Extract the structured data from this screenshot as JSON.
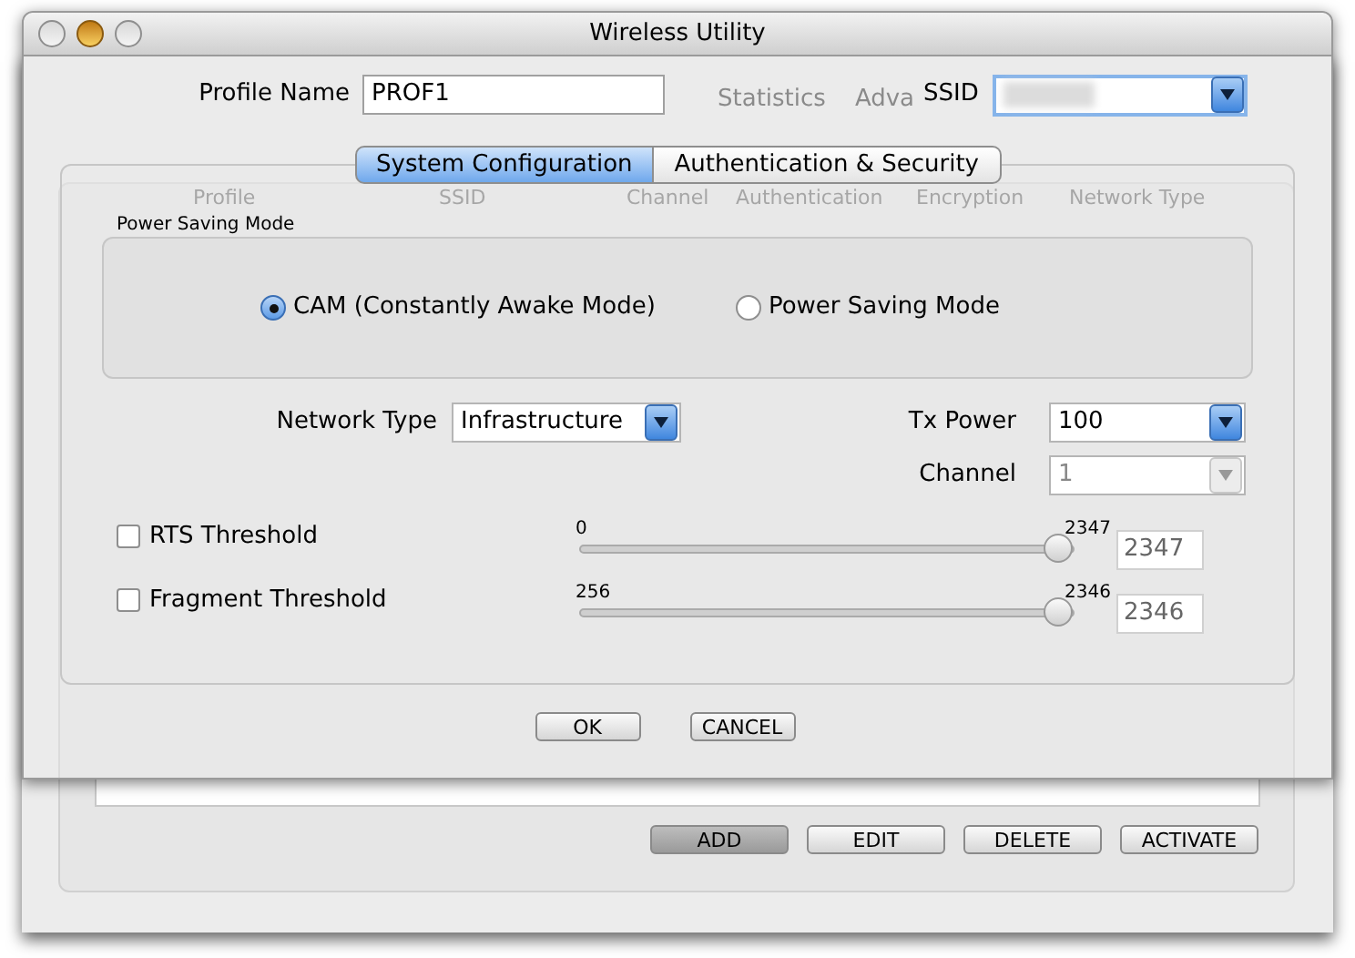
{
  "window": {
    "title": "Wireless Utility"
  },
  "background_window": {
    "tabs": [
      "Statistics",
      "Adva"
    ],
    "columns": [
      "Profile",
      "SSID",
      "Channel",
      "Authentication",
      "Encryption",
      "Network Type"
    ],
    "buttons": [
      {
        "label": "ADD",
        "selected": true
      },
      {
        "label": "EDIT",
        "selected": false
      },
      {
        "label": "DELETE",
        "selected": false
      },
      {
        "label": "ACTIVATE",
        "selected": false
      }
    ]
  },
  "profile_name": {
    "label": "Profile Name",
    "value": "PROF1"
  },
  "ssid": {
    "label": "SSID"
  },
  "tabs": [
    {
      "label": "System Configuration",
      "selected": true
    },
    {
      "label": "Authentication & Security",
      "selected": false
    }
  ],
  "power_saving": {
    "title": "Power Saving Mode",
    "options": [
      {
        "label": "CAM (Constantly Awake Mode)",
        "selected": true
      },
      {
        "label": "Power Saving Mode",
        "selected": false
      }
    ]
  },
  "network_type": {
    "label": "Network Type",
    "value": "Infrastructure"
  },
  "tx_power": {
    "label": "Tx Power",
    "value": "100"
  },
  "channel": {
    "label": "Channel",
    "value": "1",
    "disabled": true
  },
  "thresholds": [
    {
      "label": "RTS Threshold",
      "checked": false,
      "min": "0",
      "max": "2347",
      "level": 1,
      "value": "2347"
    },
    {
      "label": "Fragment Threshold",
      "checked": false,
      "min": "256",
      "max": "2346",
      "level": 1,
      "value": "2346"
    }
  ],
  "buttons": [
    "OK",
    "CANCEL"
  ]
}
